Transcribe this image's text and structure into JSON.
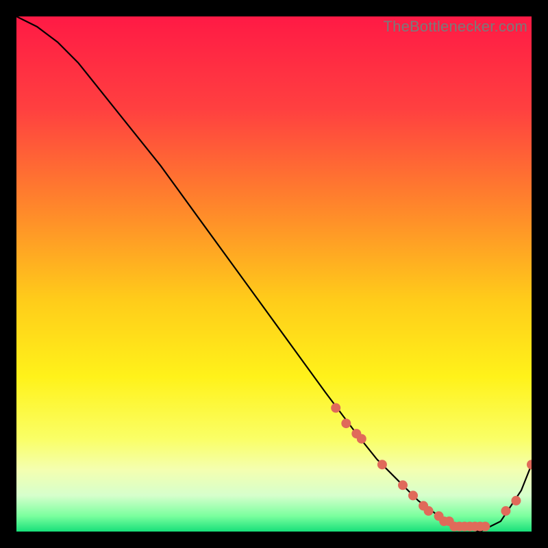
{
  "watermark": "TheBottlenecker.com",
  "chart_data": {
    "type": "line",
    "title": "",
    "xlabel": "",
    "ylabel": "",
    "xlim": [
      0,
      100
    ],
    "ylim": [
      0,
      100
    ],
    "grid": false,
    "background_gradient": {
      "stops": [
        {
          "pos": 0.0,
          "color": "#ff1a45"
        },
        {
          "pos": 0.18,
          "color": "#ff4040"
        },
        {
          "pos": 0.38,
          "color": "#ff8a2a"
        },
        {
          "pos": 0.55,
          "color": "#ffcc1a"
        },
        {
          "pos": 0.7,
          "color": "#fff21a"
        },
        {
          "pos": 0.82,
          "color": "#faff66"
        },
        {
          "pos": 0.88,
          "color": "#f4ffb0"
        },
        {
          "pos": 0.93,
          "color": "#d6ffcc"
        },
        {
          "pos": 0.97,
          "color": "#7aff9e"
        },
        {
          "pos": 1.0,
          "color": "#18e07a"
        }
      ]
    },
    "series": [
      {
        "name": "curve",
        "color": "#000000",
        "x": [
          0,
          4,
          8,
          12,
          16,
          20,
          28,
          36,
          44,
          52,
          60,
          66,
          70,
          74,
          78,
          82,
          86,
          90,
          94,
          98,
          100
        ],
        "values": [
          100,
          98,
          95,
          91,
          86,
          81,
          71,
          60,
          49,
          38,
          27,
          19,
          14,
          10,
          6,
          3,
          1,
          0,
          2,
          8,
          13
        ]
      }
    ],
    "markers": {
      "name": "dots",
      "color": "#e06a5a",
      "radius": 7,
      "x": [
        62,
        64,
        66,
        67,
        71,
        75,
        77,
        79,
        80,
        82,
        83,
        84,
        85,
        86,
        87,
        88,
        89,
        90,
        91,
        95,
        97,
        100
      ],
      "values": [
        24,
        21,
        19,
        18,
        13,
        9,
        7,
        5,
        4,
        3,
        2,
        2,
        1,
        1,
        1,
        1,
        1,
        1,
        1,
        4,
        6,
        13
      ]
    }
  }
}
